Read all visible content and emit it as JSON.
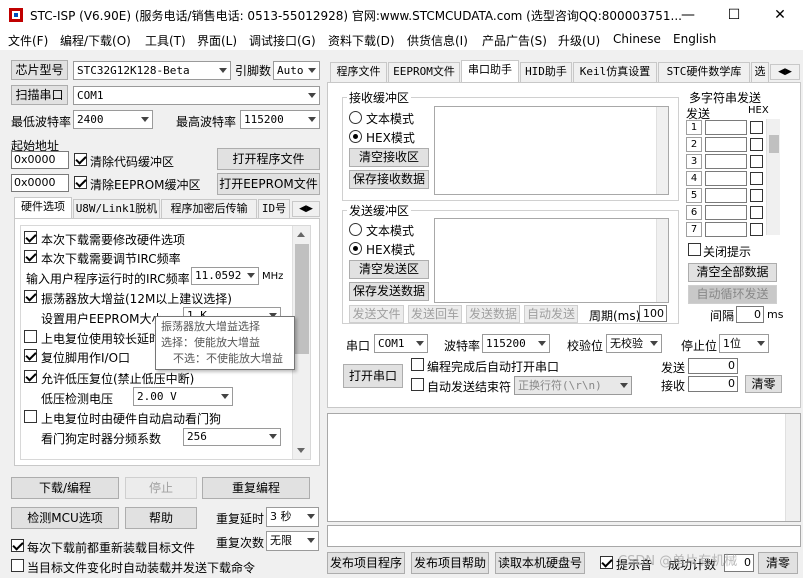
{
  "window": {
    "title": "STC-ISP (V6.90E) (服务电话/销售电话: 0513-55012928) 官网:www.STCMCUDATA.com  (选型咨询QQ:800003751...",
    "minimize": "—",
    "maximize": "☐",
    "close": "✕"
  },
  "menu": [
    "文件(F)",
    "编程/下载(O)",
    "工具(T)",
    "界面(L)",
    "调试接口(G)",
    "资料下载(D)",
    "供货信息(I)",
    "产品广告(S)",
    "升级(U)",
    "Chinese",
    "English"
  ],
  "left": {
    "chip_model_btn": "芯片型号",
    "chip_model": "STC32G12K128-Beta",
    "pin_count_label": "引脚数",
    "pin_count": "Auto",
    "scan_port_btn": "扫描串口",
    "port": "COM1",
    "min_baud_label": "最低波特率",
    "min_baud": "2400",
    "max_baud_label": "最高波特率",
    "max_baud": "115200",
    "start_addr_label": "起始地址",
    "addr1": "0x0000",
    "clear_code_buf": "清除代码缓冲区",
    "open_program_btn": "打开程序文件",
    "addr2": "0x0000",
    "clear_eeprom_buf": "清除EEPROM缓冲区",
    "open_eeprom_btn": "打开EEPROM文件",
    "tabs": [
      "硬件选项",
      "U8W/Link1脱机",
      "程序加密后传输",
      "ID号"
    ],
    "options": {
      "opt1": "本次下载需要修改硬件选项",
      "opt2": "本次下载需要调节IRC频率",
      "irc_label": "输入用户程序运行时的IRC频率",
      "irc_value": "11.0592",
      "irc_unit": "MHz",
      "opt3": "振荡器放大增益(12M以上建议选择)",
      "eeprom_size_label": "设置用户EEPROM大小",
      "eeprom_size_value": "1 K",
      "opt4": "上电复位使用较长延时",
      "opt5": "复位脚用作I/O口",
      "opt6": "允许低压复位(禁止低压中断)",
      "lvd_label": "低压检测电压",
      "lvd_value": "2.00 V",
      "opt7": "上电复位时由硬件自动启动看门狗",
      "wdt_label": "看门狗定时器分频系数",
      "wdt_value": "256"
    },
    "tooltip": {
      "line1": "振荡器放大增益选择",
      "line2": "选择：使能放大增益",
      "line3": "不选：不使能放大增益"
    },
    "download_btn": "下载/编程",
    "stop_btn": "停止",
    "reprogram_btn": "重复编程",
    "check_mcu_btn": "检测MCU选项",
    "help_btn": "帮助",
    "repeat_delay_label": "重复延时",
    "repeat_delay": "3 秒",
    "repeat_count_label": "重复次数",
    "repeat_count": "无限",
    "reload_each": "每次下载前都重新装载目标文件",
    "auto_load": "当目标文件变化时自动装载并发送下载命令"
  },
  "right": {
    "tabs": [
      "程序文件",
      "EEPROM文件",
      "串口助手",
      "HID助手",
      "Keil仿真设置",
      "STC硬件数学库",
      "选"
    ],
    "recv_group": "接收缓冲区",
    "text_mode": "文本模式",
    "hex_mode": "HEX模式",
    "clear_recv_btn": "清空接收区",
    "save_recv_btn": "保存接收数据",
    "send_group": "发送缓冲区",
    "text_mode2": "文本模式",
    "hex_mode2": "HEX模式",
    "clear_send_btn": "清空发送区",
    "save_send_btn": "保存发送数据",
    "send_file_btn": "发送文件",
    "send_return_btn": "发送回车",
    "send_data_btn": "发送数据",
    "auto_send_btn": "自动发送",
    "period_label": "周期(ms)",
    "period_value": "100",
    "multi_group": "多字符串发送",
    "send_col": "发送",
    "hex_col": "HEX",
    "rows": [
      "1",
      "2",
      "3",
      "4",
      "5",
      "6",
      "7"
    ],
    "close_tip": "关闭提示",
    "clear_all_btn": "清空全部数据",
    "auto_loop_btn": "自动循环发送",
    "interval_label": "间隔",
    "interval_value": "0",
    "interval_unit": "ms",
    "port_label": "串口",
    "port_value": "COM1",
    "baud_label": "波特率",
    "baud_value": "115200",
    "parity_label": "校验位",
    "parity_value": "无校验",
    "stop_label": "停止位",
    "stop_value": "1位",
    "open_port_btn": "打开串口",
    "auto_open": "编程完成后自动打开串口",
    "auto_send_end": "自动发送结束符",
    "end_char": "正换行符(\\r\\n)",
    "sent_label": "发送",
    "sent_value": "0",
    "recv_label": "接收",
    "recv_value": "0",
    "clear_count_btn": "清零",
    "publish_btn": "发布项目程序",
    "publish_help_btn": "发布项目帮助",
    "read_disk_btn": "读取本机硬盘号",
    "tip_sound": "提示音",
    "success_count_label": "成功计数",
    "success_count": "0",
    "clear_zero_btn": "清零"
  },
  "watermark": "CSDN @单片有机械"
}
